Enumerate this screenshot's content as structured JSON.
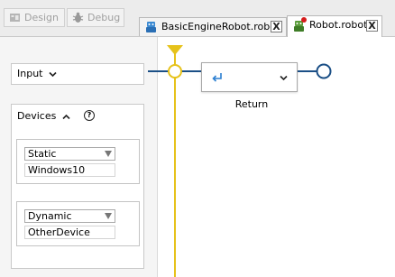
{
  "toolbar": {
    "design_label": "Design",
    "debug_label": "Debug"
  },
  "tabs": [
    {
      "label": "BasicEngineRobot.robot",
      "close": "X"
    },
    {
      "label": "Robot.robot",
      "close": "X",
      "unsaved": true
    }
  ],
  "left_panel": {
    "input_label": "Input",
    "devices_label": "Devices",
    "help_glyph": "?",
    "device_groups": [
      {
        "type": "Static",
        "value": "Windows10"
      },
      {
        "type": "Dynamic",
        "value": "OtherDevice"
      }
    ]
  },
  "flow": {
    "node_label": "Return"
  },
  "colors": {
    "flow_line_yellow": "#e6c21a",
    "flow_line_blue": "#1b4f86",
    "return_icon": "#2b7fd1"
  }
}
